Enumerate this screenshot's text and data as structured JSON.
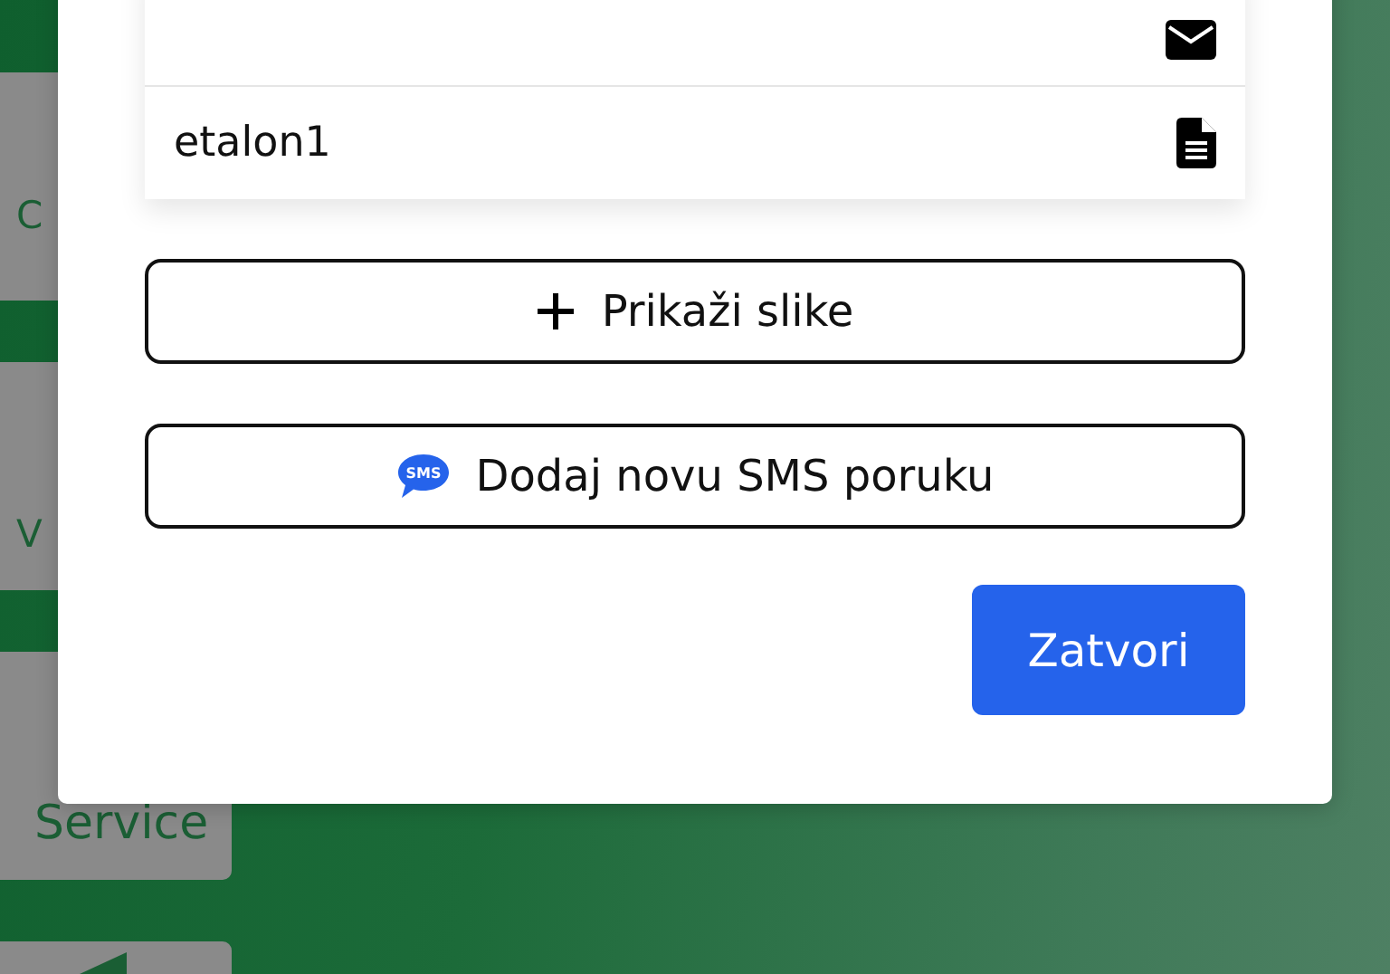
{
  "background_tiles": [
    {
      "label": "C"
    },
    {
      "label": "V"
    },
    {
      "label": "Service"
    }
  ],
  "dialog": {
    "rows": [
      {
        "kind": "mail"
      },
      {
        "kind": "document",
        "text": "etalon1"
      }
    ],
    "buttons": [
      {
        "kind": "plus",
        "label": "Prikaži slike"
      },
      {
        "kind": "sms",
        "label": "Dodaj novu SMS poruku",
        "icon_text": "SMS"
      }
    ],
    "close_button": "Zatvori"
  }
}
